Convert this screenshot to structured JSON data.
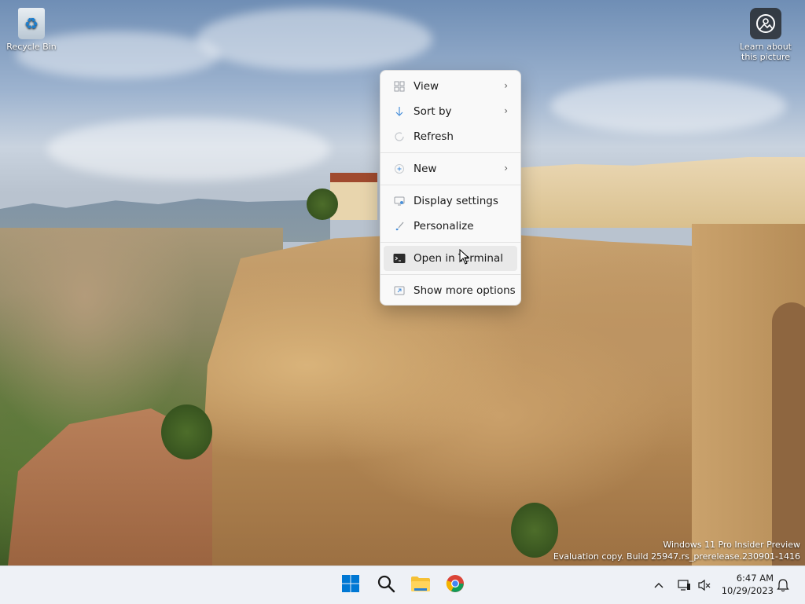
{
  "desktop": {
    "icons": [
      {
        "label": "Recycle Bin",
        "icon": "recycle-bin-icon"
      },
      {
        "label": "Learn about this picture",
        "icon": "camera-icon"
      }
    ],
    "watermark": {
      "line1": "Windows 11 Pro Insider Preview",
      "line2": "Evaluation copy. Build 25947.rs_prerelease.230901-1416"
    }
  },
  "context_menu": {
    "items": [
      {
        "label": "View",
        "icon": "view-grid-icon",
        "submenu": true
      },
      {
        "label": "Sort by",
        "icon": "sort-icon",
        "submenu": true
      },
      {
        "label": "Refresh",
        "icon": "refresh-icon",
        "submenu": false
      },
      {
        "label": "New",
        "icon": "new-plus-icon",
        "submenu": true
      },
      {
        "label": "Display settings",
        "icon": "display-icon",
        "submenu": false
      },
      {
        "label": "Personalize",
        "icon": "brush-icon",
        "submenu": false
      },
      {
        "label": "Open in Terminal",
        "icon": "terminal-icon",
        "submenu": false
      },
      {
        "label": "Show more options",
        "icon": "more-options-icon",
        "submenu": false
      }
    ]
  },
  "taskbar": {
    "apps": [
      {
        "name": "Start",
        "icon": "windows-start-icon"
      },
      {
        "name": "Search",
        "icon": "search-icon"
      },
      {
        "name": "File Explorer",
        "icon": "folder-icon"
      },
      {
        "name": "Google Chrome",
        "icon": "chrome-icon"
      }
    ],
    "tray": {
      "time": "6:47 AM",
      "date": "10/29/2023"
    }
  },
  "colors": {
    "start_blue": "#0078d4",
    "folder_yellow": "#f5c035",
    "menu_bg": "#f9f9f9",
    "taskbar_bg": "#eef1f6"
  }
}
